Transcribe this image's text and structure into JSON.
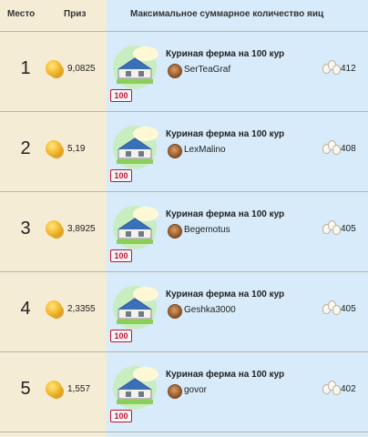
{
  "header": {
    "place": "Место",
    "prize": "Приз",
    "max": "Максимальное суммарное количество яиц"
  },
  "rows": [
    {
      "rank": "1",
      "prize": "9,0825",
      "title": "Куриная ферма на 100 кур",
      "level": "100",
      "user": "SerTeaGraf",
      "eggs": "412"
    },
    {
      "rank": "2",
      "prize": "5,19",
      "title": "Куриная ферма на 100 кур",
      "level": "100",
      "user": "LexMalino",
      "eggs": "408"
    },
    {
      "rank": "3",
      "prize": "3,8925",
      "title": "Куриная ферма на 100 кур",
      "level": "100",
      "user": "Begemotus",
      "eggs": "405"
    },
    {
      "rank": "4",
      "prize": "2,3355",
      "title": "Куриная ферма на 100 кур",
      "level": "100",
      "user": "Geshka3000",
      "eggs": "405"
    },
    {
      "rank": "5",
      "prize": "1,557",
      "title": "Куриная ферма на 100 кур",
      "level": "100",
      "user": "govor",
      "eggs": "402"
    }
  ],
  "colors": {
    "panel": "#d7ebfa",
    "background": "#f5ecd6",
    "level_badge": "#c8102e"
  },
  "icons": {
    "prize": "coin-icon",
    "farm": "chicken-farm-icon",
    "user": "avatar-icon",
    "eggs": "eggs-icon"
  }
}
